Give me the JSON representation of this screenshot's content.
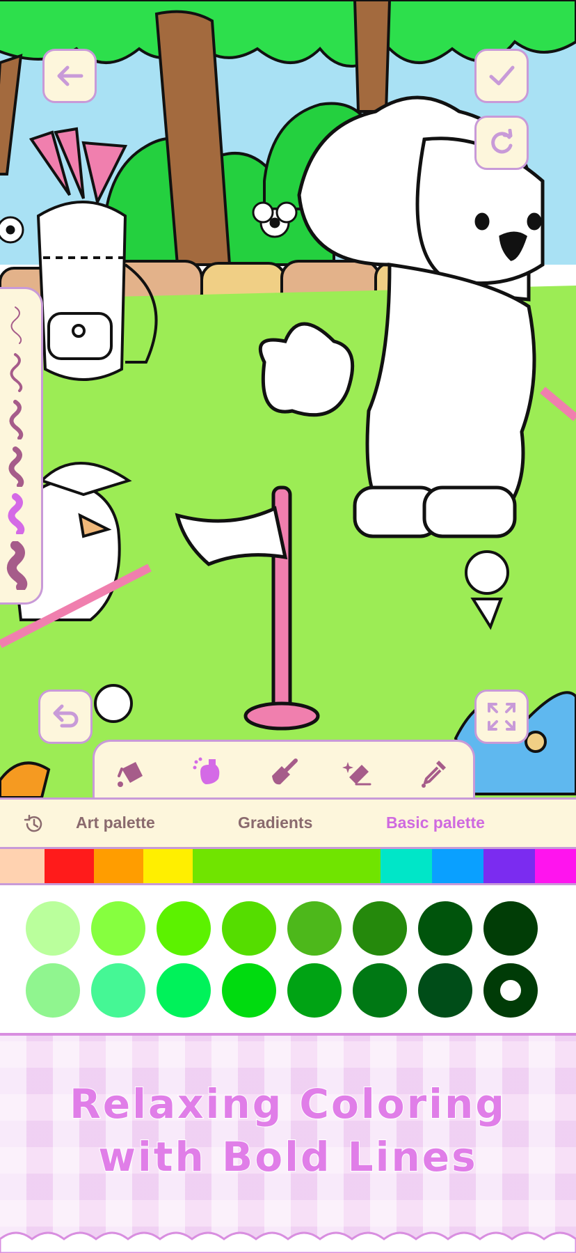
{
  "header": {
    "back_icon": "arrow-left-icon",
    "confirm_icon": "check-icon",
    "reset_icon": "refresh-icon"
  },
  "canvas": {
    "undo_icon": "undo-icon",
    "fullscreen_icon": "expand-icon"
  },
  "brushes": [
    "brush-thin-1",
    "brush-thin-2",
    "brush-medium-1",
    "brush-medium-2",
    "brush-selected-violet",
    "brush-thick"
  ],
  "tools": [
    {
      "name": "fill-bucket",
      "icon": "paint-bucket-icon"
    },
    {
      "name": "spray",
      "icon": "spray-icon",
      "selected": true
    },
    {
      "name": "paint-brush",
      "icon": "paint-brush-icon"
    },
    {
      "name": "eraser",
      "icon": "eraser-icon"
    },
    {
      "name": "eyedropper",
      "icon": "eyedropper-icon"
    }
  ],
  "palette_tabs": {
    "history_icon": "history-icon",
    "art": "Art palette",
    "gradients": "Gradients",
    "basic": "Basic palette",
    "active": "basic"
  },
  "hue_strip": [
    "#ffd2b0",
    "#ff1b1b",
    "#ff9d00",
    "#ffef00",
    "#70e400",
    "#00e6c8",
    "#0aa0ff",
    "#7b2cf0",
    "#ff14ee"
  ],
  "selected_hue": "#70e400",
  "swatches_row1": [
    "#baff9c",
    "#86ff3f",
    "#5cf200",
    "#55dd00",
    "#4db81b",
    "#25890c",
    "#00540c",
    "#013d06"
  ],
  "swatches_row2": [
    "#90f58f",
    "#45f795",
    "#00f25a",
    "#00db0f",
    "#00a314",
    "#007814",
    "#004d18",
    "#003b07"
  ],
  "selected_swatch": "#003b07",
  "promo": {
    "line1": "Relaxing Coloring",
    "line2": "with Bold Lines"
  },
  "colors": {
    "accent": "#c89ad8",
    "cream": "#fdf6dc",
    "tab_active": "#cf6ae0",
    "tab_inactive": "#8a6a6e",
    "promo_text": "#e07ee8"
  }
}
